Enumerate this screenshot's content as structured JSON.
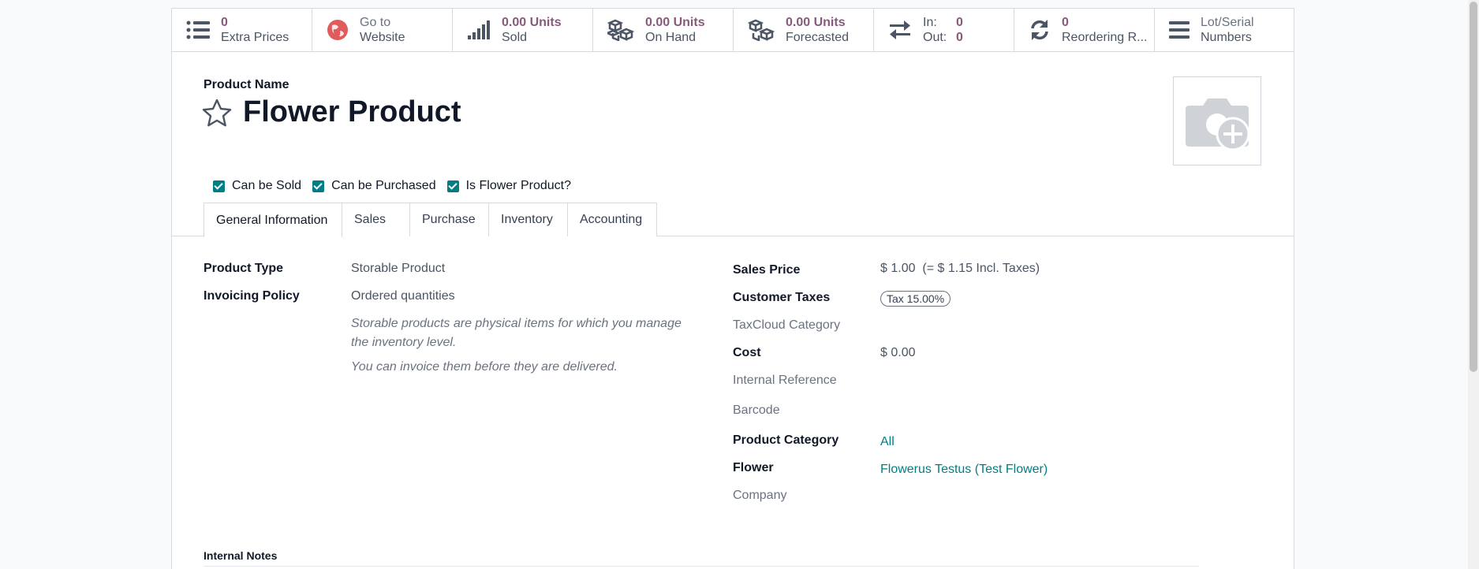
{
  "statbar": {
    "extra_prices": {
      "value": "0",
      "label": "Extra Prices",
      "icon": "list-icon"
    },
    "go_to_website": {
      "line1": "Go to",
      "line2": "Website",
      "icon": "globe-icon"
    },
    "units_sold": {
      "value": "0.00 Units",
      "label": "Sold",
      "icon": "signal-icon"
    },
    "on_hand": {
      "value": "0.00 Units",
      "label": "On Hand",
      "icon": "cubes-icon"
    },
    "forecasted": {
      "value": "0.00 Units",
      "label": "Forecasted",
      "icon": "cubes-icon"
    },
    "in_out": {
      "in_label": "In:",
      "in_value": "0",
      "out_label": "Out:",
      "out_value": "0",
      "icon": "exchange-icon"
    },
    "reordering": {
      "value": "0",
      "label": "Reordering R...",
      "icon": "refresh-icon"
    },
    "lots": {
      "line1": "Lot/Serial",
      "line2": "Numbers",
      "icon": "bars-icon"
    }
  },
  "form": {
    "name_label": "Product Name",
    "product_name": "Flower Product",
    "checkboxes": [
      {
        "label": "Can be Sold",
        "checked": true
      },
      {
        "label": "Can be Purchased",
        "checked": true
      },
      {
        "label": "Is Flower Product?",
        "checked": true
      }
    ],
    "tabs": [
      "General Information",
      "Sales",
      "Purchase",
      "Inventory",
      "Accounting"
    ],
    "active_tab": "General Information",
    "left": {
      "product_type_label": "Product Type",
      "product_type": "Storable Product",
      "invoicing_label": "Invoicing Policy",
      "invoicing": "Ordered quantities",
      "help1": "Storable products are physical items for which you manage the inventory level.",
      "help2": "You can invoice them before they are delivered."
    },
    "right": {
      "sales_price_label": "Sales Price",
      "sales_price": "$ 1.00",
      "sales_price_incl": "(= $ 1.15 Incl. Taxes)",
      "customer_taxes_label": "Customer Taxes",
      "tax_badge": "Tax 15.00%",
      "taxcloud_label": "TaxCloud Category",
      "cost_label": "Cost",
      "cost": "$ 0.00",
      "internal_ref_label": "Internal Reference",
      "barcode_label": "Barcode",
      "category_label": "Product Category",
      "category": "All",
      "flower_label": "Flower",
      "flower": "Flowerus Testus (Test Flower)",
      "company_label": "Company"
    },
    "internal_notes_label": "Internal Notes"
  },
  "colors": {
    "accent": "#875a7b",
    "link": "#017e84"
  }
}
